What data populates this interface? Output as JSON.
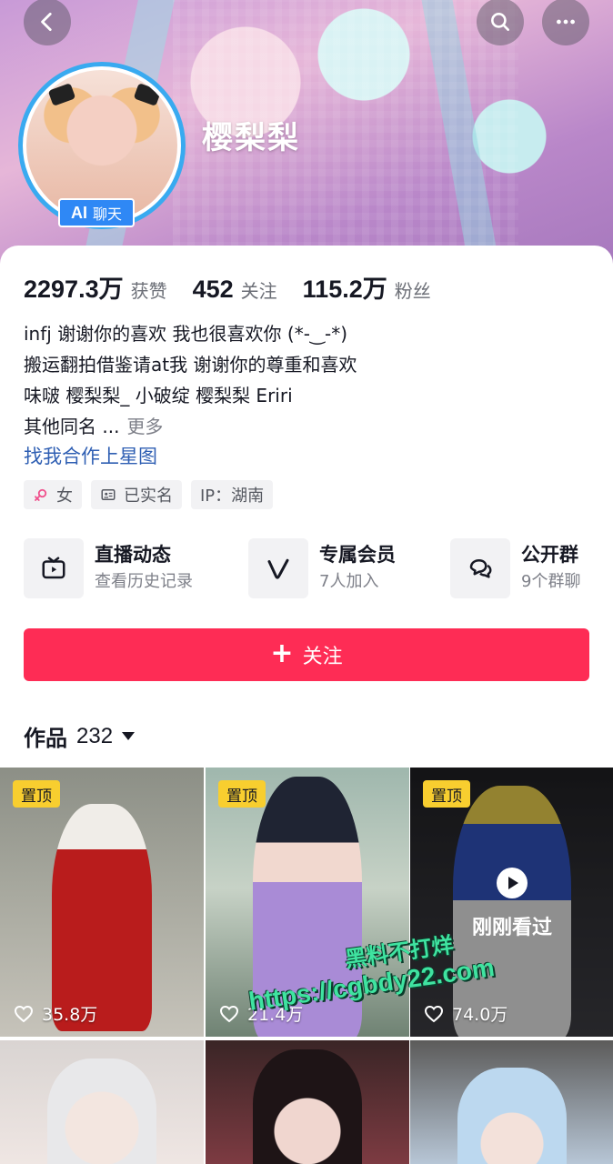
{
  "header": {
    "nickname": "樱梨梨",
    "ai_badge": {
      "ai": "AI",
      "label": "聊天"
    },
    "icons": [
      "back-arrow-icon",
      "search-icon",
      "more-dots-icon"
    ]
  },
  "stats": [
    {
      "value": "2297.3万",
      "label": "获赞"
    },
    {
      "value": "452",
      "label": "关注"
    },
    {
      "value": "115.2万",
      "label": "粉丝"
    }
  ],
  "bio": {
    "lines": [
      "infj 谢谢你的喜欢 我也很喜欢你 (*-‿-*)",
      "搬运翻拍借鉴请at我 谢谢你的尊重和喜欢",
      "味啵 樱梨梨_ 小破绽 樱梨梨 Eriri",
      "其他同名 ..."
    ],
    "more_label": "更多",
    "link": "找我合作上星图"
  },
  "tags": [
    {
      "icon": "female-icon",
      "label": "女"
    },
    {
      "icon": "id-card-icon",
      "label": "已实名"
    },
    {
      "icon": "",
      "label": "IP：湖南"
    }
  ],
  "features": [
    {
      "icon": "tv-play-icon",
      "title": "直播动态",
      "sub": "查看历史记录"
    },
    {
      "icon": "v-member-icon",
      "title": "专属会员",
      "sub": "7人加入"
    },
    {
      "icon": "chat-bubbles-icon",
      "title": "公开群",
      "sub": "9个群聊"
    }
  ],
  "follow_button": {
    "label": "关注",
    "color": "#fe2c55"
  },
  "works": {
    "label": "作品",
    "count": "232"
  },
  "videos": [
    {
      "pinned": "置顶",
      "likes": "35.8万"
    },
    {
      "pinned": "置顶",
      "likes": "21.4万"
    },
    {
      "pinned": "置顶",
      "likes": "74.0万",
      "overlay": "刚刚看过"
    },
    {
      "likes": ""
    },
    {
      "likes": ""
    },
    {
      "likes": ""
    }
  ],
  "watermark": {
    "line1": "黑料不打烊",
    "line2": "https://cgbdy22.com"
  },
  "colors": {
    "accent": "#fe2c55",
    "link": "#2f5fb3",
    "pin": "#f8ce2f",
    "ai_badge": "#2f88f5"
  }
}
